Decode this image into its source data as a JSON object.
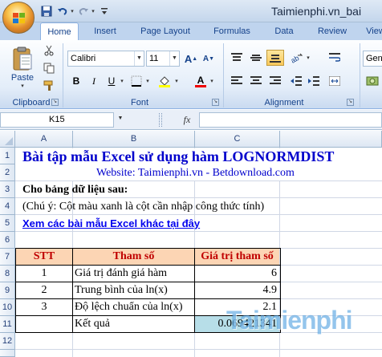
{
  "titlebar": {
    "watermark": "Taimienphi.vn_bai"
  },
  "tabs": [
    "Home",
    "Insert",
    "Page Layout",
    "Formulas",
    "Data",
    "Review",
    "View"
  ],
  "ribbon": {
    "clipboard": {
      "paste_label": "Paste",
      "group_label": "Clipboard"
    },
    "font": {
      "name": "Calibri",
      "size": "11",
      "group_label": "Font",
      "bold": "B",
      "italic": "I",
      "underline": "U"
    },
    "alignment": {
      "group_label": "Alignment"
    },
    "number": {
      "format": "Gen"
    }
  },
  "formula_bar": {
    "name_box": "K15",
    "fx": "fx",
    "formula": ""
  },
  "columns": [
    "A",
    "B",
    "C"
  ],
  "rows": [
    "1",
    "2",
    "3",
    "4",
    "5",
    "6",
    "7",
    "8",
    "9",
    "10",
    "11",
    "12"
  ],
  "sheet": {
    "title": "Bài tập mẫu Excel sử dụng hàm LOGNORMDIST",
    "website": "Website: Taimienphi.vn - Betdownload.com",
    "given": "Cho bảng dữ liệu sau:",
    "note": "(Chú ý: Cột màu xanh là cột cần nhập công thức tính)",
    "link": "Xem các bài mẫu Excel khác tại đây",
    "headers": {
      "stt": "STT",
      "param": "Tham số",
      "value": "Giá trị tham số"
    },
    "rows": [
      {
        "stt": "1",
        "param": "Giá trị đánh giá hàm",
        "value": "6"
      },
      {
        "stt": "2",
        "param": "Trung bình của ln(x)",
        "value": "4.9"
      },
      {
        "stt": "3",
        "param": "Độ lệch chuẩn của ln(x)",
        "value": "2.1"
      }
    ],
    "result_label": "Kết quả",
    "result_value": "0.069421341"
  },
  "watermark": "Taimienphi",
  "colors": {
    "header_fill": "#fcd5b4",
    "header_text": "#c00000",
    "result_fill": "#b7dee8",
    "title_text": "#0000cc"
  }
}
